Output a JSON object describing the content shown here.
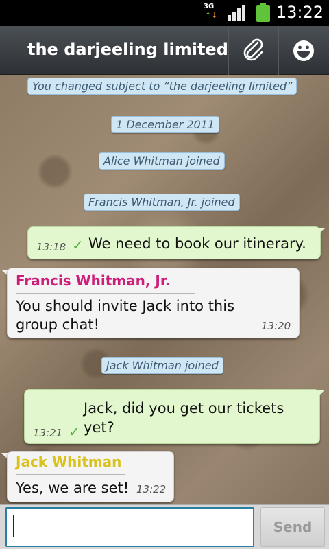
{
  "status_bar": {
    "network_label": "3G",
    "time": "13:22",
    "battery_color": "#5fc43a",
    "icons": [
      "network-3g-icon",
      "signal-icon",
      "battery-icon"
    ]
  },
  "header": {
    "title": "the darjeeling limited",
    "attach_icon": "paperclip-icon",
    "emoji_icon": "smiley-icon"
  },
  "system_messages": [
    "You changed subject to “the darjeeling limited”",
    "1 December 2011",
    "Alice Whitman joined",
    "Francis Whitman, Jr. joined",
    "Jack Whitman joined"
  ],
  "messages": [
    {
      "direction": "out",
      "text": "We need to book our itinerary.",
      "time": "13:18",
      "status": "delivered"
    },
    {
      "direction": "in",
      "sender": "Francis Whitman, Jr.",
      "sender_color": "#cc1f7a",
      "text_lines": [
        "You should invite Jack into this",
        "group chat!"
      ],
      "time": "13:20"
    },
    {
      "direction": "out",
      "text_lines": [
        "Jack, did you get our tickets",
        "yet?"
      ],
      "time": "13:21",
      "status": "delivered"
    },
    {
      "direction": "in",
      "sender": "Jack Whitman",
      "sender_color": "#d9c21c",
      "text": "Yes, we are set!",
      "time": "13:22"
    }
  ],
  "composer": {
    "value": "",
    "send_label": "Send"
  },
  "colors": {
    "outgoing_bubble": "#e2f7cd",
    "incoming_bubble": "#f4f4f4",
    "system_bubble": "#cfe6f5",
    "check": "#4fb23a"
  }
}
